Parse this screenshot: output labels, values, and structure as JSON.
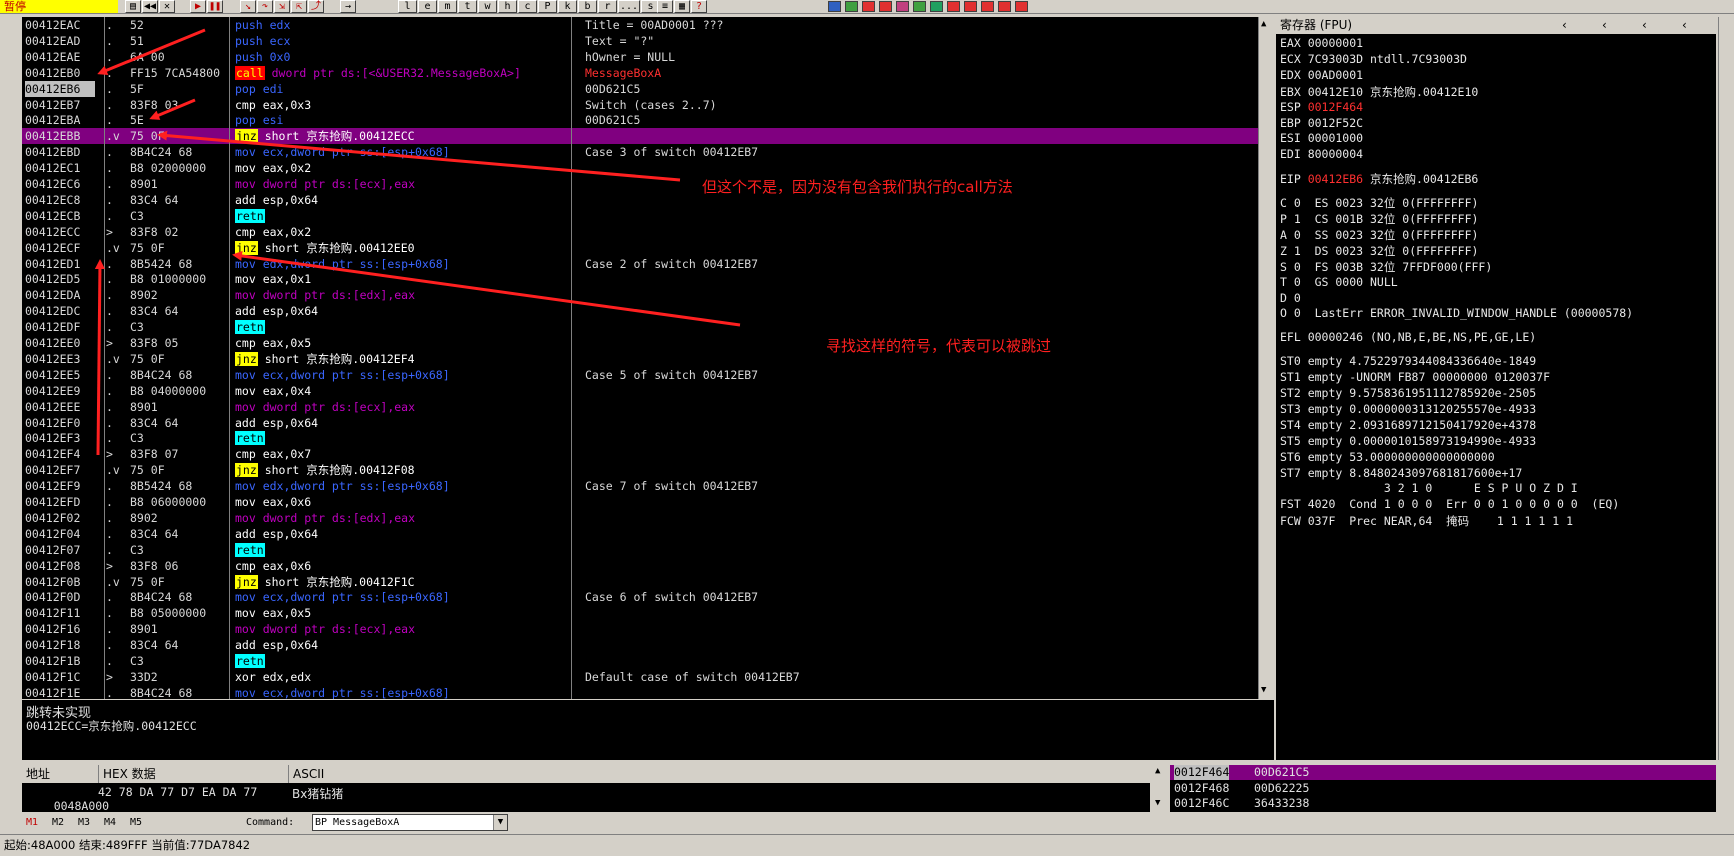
{
  "toolbar": {
    "status": "暂停",
    "letters": [
      "l",
      "e",
      "m",
      "t",
      "w",
      "h",
      "c",
      "P",
      "k",
      "b",
      "r",
      "...",
      "s"
    ]
  },
  "cpu": {
    "rows": [
      {
        "addr": "00412EAC",
        "mark": ".",
        "hex": "52",
        "asm": [
          {
            "t": "push edx",
            "c": "bl"
          }
        ],
        "cmt": "Title = 00AD0001 ???"
      },
      {
        "addr": "00412EAD",
        "mark": ".",
        "hex": "51",
        "asm": [
          {
            "t": "push ecx",
            "c": "bl"
          }
        ],
        "cmt": "Text = \"?\""
      },
      {
        "addr": "00412EAE",
        "mark": ".",
        "hex": "6A 00",
        "asm": [
          {
            "t": "push 0x0",
            "c": "bl"
          }
        ],
        "cmt": "hOwner = NULL"
      },
      {
        "addr": "00412EB0",
        "mark": ".",
        "hex": "FF15 7CA54800",
        "asm": [
          {
            "t": "call",
            "c": "g-call"
          },
          {
            "t": " dword ptr ds:[<&USER32.MessageBoxA>]",
            "c": "mg"
          }
        ],
        "cmt": "MessageBoxA",
        "cmtc": "rd"
      },
      {
        "addr": "00412EB6",
        "mark": ".",
        "hex": "5F",
        "asm": [
          {
            "t": "pop edi",
            "c": "bl"
          }
        ],
        "cmt": "00D621C5",
        "eip": true
      },
      {
        "addr": "00412EB7",
        "mark": ".",
        "hex": "83F8 03",
        "asm": [
          {
            "t": "cmp eax,0x3",
            "c": "w"
          }
        ],
        "cmt": "Switch (cases 2..7)"
      },
      {
        "addr": "00412EBA",
        "mark": ".",
        "hex": "5E",
        "asm": [
          {
            "t": "pop esi",
            "c": "bl"
          }
        ],
        "cmt": "00D621C5"
      },
      {
        "addr": "00412EBB",
        "mark": ".v",
        "hex": "75 0F",
        "asm": [
          {
            "t": "jnz",
            "c": "g-jnz"
          },
          {
            "t": " short 京东抢购.00412ECC",
            "c": "w"
          }
        ],
        "cmt": "",
        "sel": true
      },
      {
        "addr": "00412EBD",
        "mark": ".",
        "hex": "8B4C24 68",
        "asm": [
          {
            "t": "mov ecx,dword ptr ss:[esp+0x68]",
            "c": "bl"
          }
        ],
        "cmt": "Case 3 of switch 00412EB7"
      },
      {
        "addr": "00412EC1",
        "mark": ".",
        "hex": "B8 02000000",
        "asm": [
          {
            "t": "mov eax,0x2",
            "c": "w"
          }
        ],
        "cmt": ""
      },
      {
        "addr": "00412EC6",
        "mark": ".",
        "hex": "8901",
        "asm": [
          {
            "t": "mov dword ptr ds:[ecx],eax",
            "c": "mg"
          }
        ],
        "cmt": ""
      },
      {
        "addr": "00412EC8",
        "mark": ".",
        "hex": "83C4 64",
        "asm": [
          {
            "t": "add esp,0x64",
            "c": "w"
          }
        ],
        "cmt": ""
      },
      {
        "addr": "00412ECB",
        "mark": ".",
        "hex": "C3",
        "asm": [
          {
            "t": "retn",
            "c": "g-retn"
          }
        ],
        "cmt": ""
      },
      {
        "addr": "00412ECC",
        "mark": ">",
        "hex": "83F8 02",
        "asm": [
          {
            "t": "cmp eax,0x2",
            "c": "w"
          }
        ],
        "cmt": ""
      },
      {
        "addr": "00412ECF",
        "mark": ".v",
        "hex": "75 0F",
        "asm": [
          {
            "t": "jnz",
            "c": "g-jnz"
          },
          {
            "t": " short 京东抢购.00412EE0",
            "c": "w"
          }
        ],
        "cmt": ""
      },
      {
        "addr": "00412ED1",
        "mark": ".",
        "hex": "8B5424 68",
        "asm": [
          {
            "t": "mov edx,dword ptr ss:[esp+0x68]",
            "c": "bl"
          }
        ],
        "cmt": "Case 2 of switch 00412EB7"
      },
      {
        "addr": "00412ED5",
        "mark": ".",
        "hex": "B8 01000000",
        "asm": [
          {
            "t": "mov eax,0x1",
            "c": "w"
          }
        ],
        "cmt": ""
      },
      {
        "addr": "00412EDA",
        "mark": ".",
        "hex": "8902",
        "asm": [
          {
            "t": "mov dword ptr ds:[edx],eax",
            "c": "mg"
          }
        ],
        "cmt": ""
      },
      {
        "addr": "00412EDC",
        "mark": ".",
        "hex": "83C4 64",
        "asm": [
          {
            "t": "add esp,0x64",
            "c": "w"
          }
        ],
        "cmt": ""
      },
      {
        "addr": "00412EDF",
        "mark": ".",
        "hex": "C3",
        "asm": [
          {
            "t": "retn",
            "c": "g-retn"
          }
        ],
        "cmt": ""
      },
      {
        "addr": "00412EE0",
        "mark": ">",
        "hex": "83F8 05",
        "asm": [
          {
            "t": "cmp eax,0x5",
            "c": "w"
          }
        ],
        "cmt": ""
      },
      {
        "addr": "00412EE3",
        "mark": ".v",
        "hex": "75 0F",
        "asm": [
          {
            "t": "jnz",
            "c": "g-jnz"
          },
          {
            "t": " short 京东抢购.00412EF4",
            "c": "w"
          }
        ],
        "cmt": ""
      },
      {
        "addr": "00412EE5",
        "mark": ".",
        "hex": "8B4C24 68",
        "asm": [
          {
            "t": "mov ecx,dword ptr ss:[esp+0x68]",
            "c": "bl"
          }
        ],
        "cmt": "Case 5 of switch 00412EB7"
      },
      {
        "addr": "00412EE9",
        "mark": ".",
        "hex": "B8 04000000",
        "asm": [
          {
            "t": "mov eax,0x4",
            "c": "w"
          }
        ],
        "cmt": ""
      },
      {
        "addr": "00412EEE",
        "mark": ".",
        "hex": "8901",
        "asm": [
          {
            "t": "mov dword ptr ds:[ecx],eax",
            "c": "mg"
          }
        ],
        "cmt": ""
      },
      {
        "addr": "00412EF0",
        "mark": ".",
        "hex": "83C4 64",
        "asm": [
          {
            "t": "add esp,0x64",
            "c": "w"
          }
        ],
        "cmt": ""
      },
      {
        "addr": "00412EF3",
        "mark": ".",
        "hex": "C3",
        "asm": [
          {
            "t": "retn",
            "c": "g-retn"
          }
        ],
        "cmt": ""
      },
      {
        "addr": "00412EF4",
        "mark": ">",
        "hex": "83F8 07",
        "asm": [
          {
            "t": "cmp eax,0x7",
            "c": "w"
          }
        ],
        "cmt": ""
      },
      {
        "addr": "00412EF7",
        "mark": ".v",
        "hex": "75 0F",
        "asm": [
          {
            "t": "jnz",
            "c": "g-jnz"
          },
          {
            "t": " short 京东抢购.00412F08",
            "c": "w"
          }
        ],
        "cmt": ""
      },
      {
        "addr": "00412EF9",
        "mark": ".",
        "hex": "8B5424 68",
        "asm": [
          {
            "t": "mov edx,dword ptr ss:[esp+0x68]",
            "c": "bl"
          }
        ],
        "cmt": "Case 7 of switch 00412EB7"
      },
      {
        "addr": "00412EFD",
        "mark": ".",
        "hex": "B8 06000000",
        "asm": [
          {
            "t": "mov eax,0x6",
            "c": "w"
          }
        ],
        "cmt": ""
      },
      {
        "addr": "00412F02",
        "mark": ".",
        "hex": "8902",
        "asm": [
          {
            "t": "mov dword ptr ds:[edx],eax",
            "c": "mg"
          }
        ],
        "cmt": ""
      },
      {
        "addr": "00412F04",
        "mark": ".",
        "hex": "83C4 64",
        "asm": [
          {
            "t": "add esp,0x64",
            "c": "w"
          }
        ],
        "cmt": ""
      },
      {
        "addr": "00412F07",
        "mark": ".",
        "hex": "C3",
        "asm": [
          {
            "t": "retn",
            "c": "g-retn"
          }
        ],
        "cmt": ""
      },
      {
        "addr": "00412F08",
        "mark": ">",
        "hex": "83F8 06",
        "asm": [
          {
            "t": "cmp eax,0x6",
            "c": "w"
          }
        ],
        "cmt": ""
      },
      {
        "addr": "00412F0B",
        "mark": ".v",
        "hex": "75 0F",
        "asm": [
          {
            "t": "jnz",
            "c": "g-jnz"
          },
          {
            "t": " short 京东抢购.00412F1C",
            "c": "w"
          }
        ],
        "cmt": ""
      },
      {
        "addr": "00412F0D",
        "mark": ".",
        "hex": "8B4C24 68",
        "asm": [
          {
            "t": "mov ecx,dword ptr ss:[esp+0x68]",
            "c": "bl"
          }
        ],
        "cmt": "Case 6 of switch 00412EB7"
      },
      {
        "addr": "00412F11",
        "mark": ".",
        "hex": "B8 05000000",
        "asm": [
          {
            "t": "mov eax,0x5",
            "c": "w"
          }
        ],
        "cmt": ""
      },
      {
        "addr": "00412F16",
        "mark": ".",
        "hex": "8901",
        "asm": [
          {
            "t": "mov dword ptr ds:[ecx],eax",
            "c": "mg"
          }
        ],
        "cmt": ""
      },
      {
        "addr": "00412F18",
        "mark": ".",
        "hex": "83C4 64",
        "asm": [
          {
            "t": "add esp,0x64",
            "c": "w"
          }
        ],
        "cmt": ""
      },
      {
        "addr": "00412F1B",
        "mark": ".",
        "hex": "C3",
        "asm": [
          {
            "t": "retn",
            "c": "g-retn"
          }
        ],
        "cmt": ""
      },
      {
        "addr": "00412F1C",
        "mark": ">",
        "hex": "33D2",
        "asm": [
          {
            "t": "xor edx,edx",
            "c": "w"
          }
        ],
        "cmt": "Default case of switch 00412EB7"
      },
      {
        "addr": "00412F1E",
        "mark": ".",
        "hex": "8B4C24 68",
        "asm": [
          {
            "t": "mov ecx,dword ptr ss:[esp+0x68]",
            "c": "bl"
          }
        ],
        "cmt": ""
      }
    ]
  },
  "info": {
    "line1": "跳转未实现",
    "line2": "00412ECC=京东抢购.00412ECC"
  },
  "registers": {
    "header": "寄存器 (FPU)",
    "lines": [
      {
        "t": "EAX 00000001"
      },
      {
        "t": "ECX 7C93003D ntdll.7C93003D"
      },
      {
        "t": "EDX 00AD0001"
      },
      {
        "t": "EBX 00412E10 京东抢购.00412E10"
      },
      {
        "t": "ESP 0012F464",
        "red": "0012F464",
        "pre": "ESP "
      },
      {
        "t": "EBP 0012F52C"
      },
      {
        "t": "ESI 00001000"
      },
      {
        "t": "EDI 80000004"
      },
      {
        "t": ""
      },
      {
        "t": "EIP 00412EB6 京东抢购.00412EB6",
        "red": "00412EB6",
        "pre": "EIP ",
        "post": " 京东抢购.00412EB6"
      },
      {
        "t": ""
      },
      {
        "t": "C 0  ES 0023 32位 0(FFFFFFFF)"
      },
      {
        "t": "P 1  CS 001B 32位 0(FFFFFFFF)"
      },
      {
        "t": "A 0  SS 0023 32位 0(FFFFFFFF)"
      },
      {
        "t": "Z 1  DS 0023 32位 0(FFFFFFFF)"
      },
      {
        "t": "S 0  FS 003B 32位 7FFDF000(FFF)"
      },
      {
        "t": "T 0  GS 0000 NULL"
      },
      {
        "t": "D 0"
      },
      {
        "t": "O 0  LastErr ERROR_INVALID_WINDOW_HANDLE (00000578)"
      },
      {
        "t": ""
      },
      {
        "t": "EFL 00000246 (NO,NB,E,BE,NS,PE,GE,LE)"
      },
      {
        "t": ""
      },
      {
        "t": "ST0 empty 4.7522979344084336640e-1849"
      },
      {
        "t": "ST1 empty -UNORM FB87 00000000 0120037F"
      },
      {
        "t": "ST2 empty 9.5758361951112785920e-2505"
      },
      {
        "t": "ST3 empty 0.0000000313120255570e-4933"
      },
      {
        "t": "ST4 empty 2.0931689712150417920e+4378"
      },
      {
        "t": "ST5 empty 0.0000010158973194990e-4933"
      },
      {
        "t": "ST6 empty 53.000000000000000000"
      },
      {
        "t": "ST7 empty 8.8480243097681817600e+17"
      },
      {
        "t": "               3 2 1 0      E S P U O Z D I"
      },
      {
        "t": "FST 4020  Cond 1 0 0 0  Err 0 0 1 0 0 0 0 0  (EQ)"
      },
      {
        "t": "FCW 037F  Prec NEAR,64  掩码    1 1 1 1 1 1"
      }
    ]
  },
  "dump": {
    "col_addr": "地址",
    "col_hex": "HEX 数据",
    "col_ascii": "ASCII",
    "row_addr": "0048A000",
    "row_hex": "42 78 DA 77 D7 EA DA 77",
    "row_ascii": "Bx猪钻猪"
  },
  "stack": {
    "rows": [
      {
        "addr": "0012F464",
        "val": "00D621C5",
        "sel": true
      },
      {
        "addr": "0012F468",
        "val": "00D62225"
      },
      {
        "addr": "0012F46C",
        "val": "36433238"
      }
    ]
  },
  "command": {
    "tabs": [
      "M1",
      "M2",
      "M3",
      "M4",
      "M5"
    ],
    "label": "Command:",
    "value": "BP  MessageBoxA"
  },
  "status": {
    "text": "起始:48A000 结束:489FFF 当前值:77DA7842"
  },
  "annotations": {
    "note1": "但这个不是，因为没有包含我们执行的call方法",
    "note2": "寻找这样的符号，代表可以被跳过"
  }
}
